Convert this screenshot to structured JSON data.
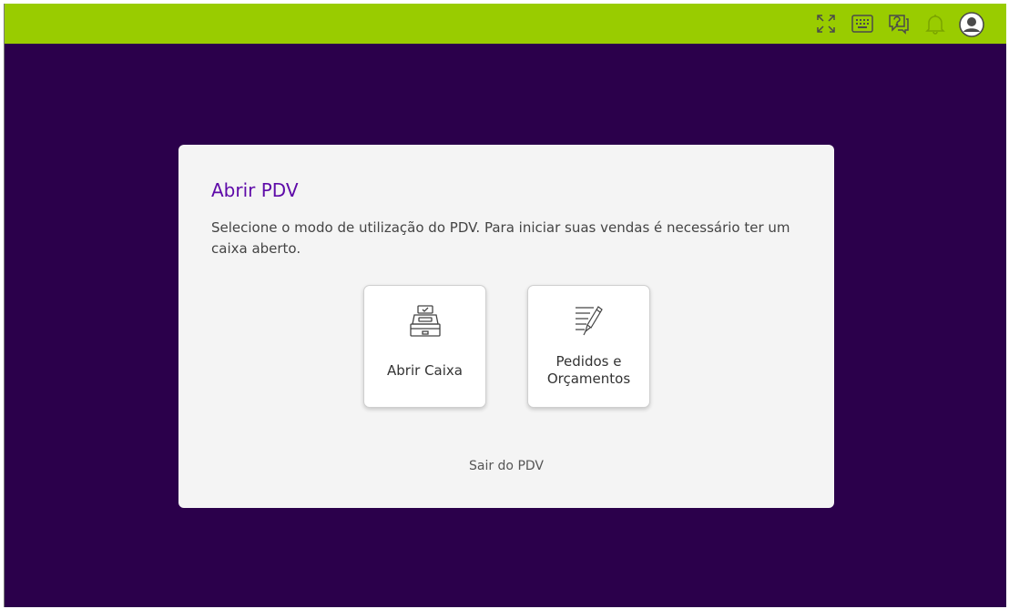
{
  "topbar": {
    "background": "#99cc00",
    "icons": [
      "fullscreen-icon",
      "keyboard-icon",
      "help-chat-icon",
      "notification-bell-icon",
      "user-avatar-icon"
    ]
  },
  "modal": {
    "title": "Abrir PDV",
    "description": "Selecione o modo de utilização do PDV. Para iniciar suas vendas é necessário ter um caixa aberto.",
    "options": [
      {
        "label": "Abrir Caixa",
        "icon": "cash-register-icon"
      },
      {
        "label": "Pedidos e Orçamentos",
        "icon": "order-notes-pen-icon"
      }
    ],
    "exit_label": "Sair do PDV"
  },
  "colors": {
    "background": "#2b004b",
    "accent": "#5e0aa8",
    "topbar": "#99cc00"
  }
}
